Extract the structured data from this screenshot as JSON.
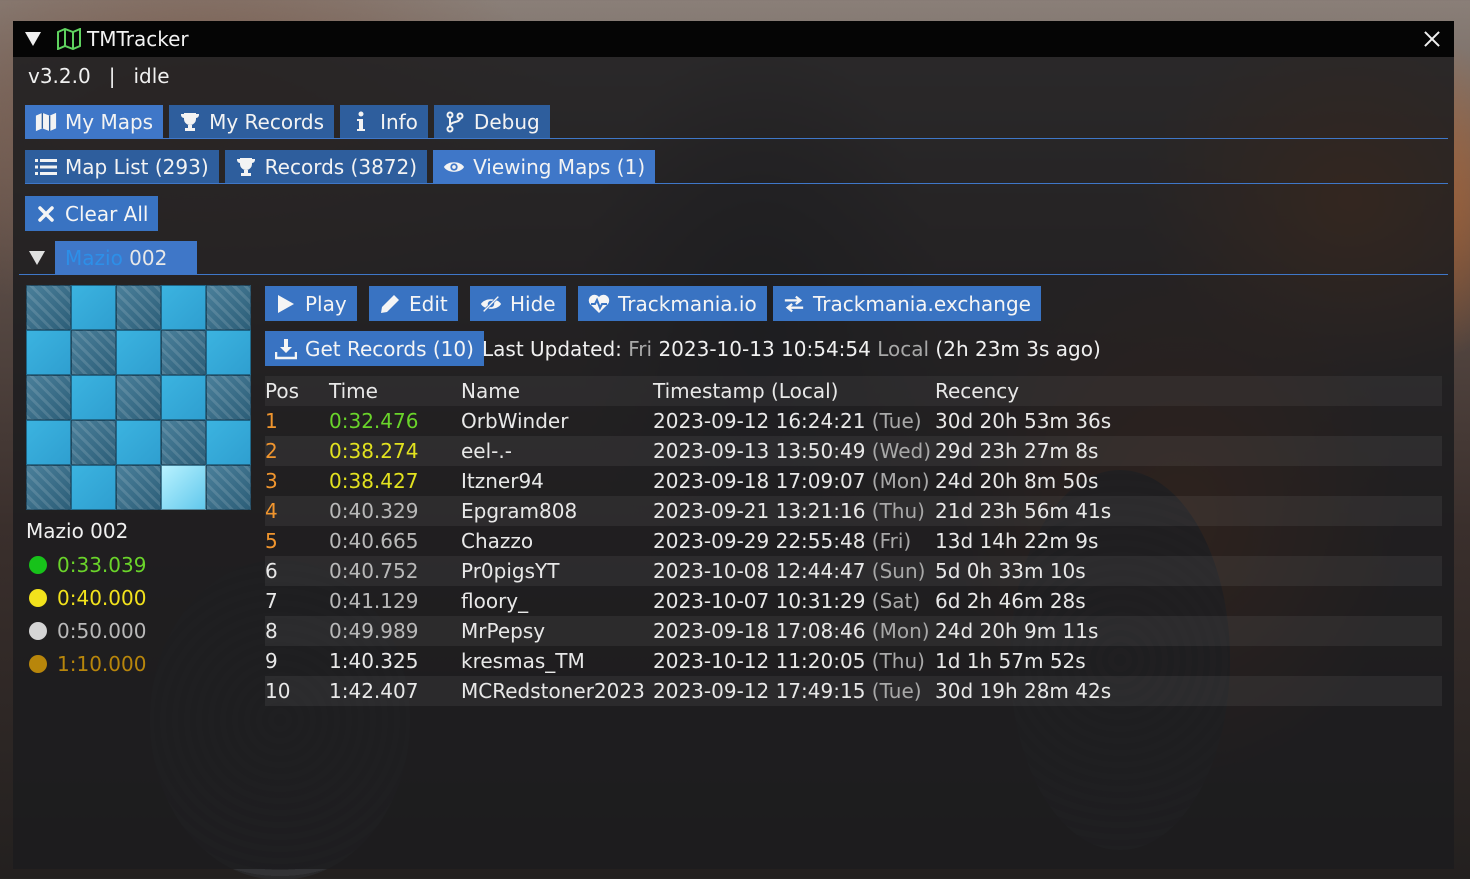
{
  "colors": {
    "accent": "#3f77c8",
    "button": "#3973c2",
    "author_medal": "#17c21a",
    "gold_medal": "#f2e21c",
    "silver_medal": "#d5d5d5",
    "bronze_medal": "#b8860b",
    "rank_top": "#f0952e",
    "time_author": "#6ad42a",
    "time_gold": "#e2e21f"
  },
  "window": {
    "title": "TMTracker",
    "title_icon": "map-icon",
    "version": "v3.2.0",
    "separator": "|",
    "status": "idle"
  },
  "main_tabs": [
    {
      "label": "My Maps",
      "icon": "map-icon"
    },
    {
      "label": "My Records",
      "icon": "trophy-icon"
    },
    {
      "label": "Info",
      "icon": "info-icon"
    },
    {
      "label": "Debug",
      "icon": "code-branch-icon"
    }
  ],
  "sub_tabs": [
    {
      "label": "Map List (293)",
      "icon": "list-icon"
    },
    {
      "label": "Records (3872)",
      "icon": "trophy-icon"
    },
    {
      "label": "Viewing Maps (1)",
      "icon": "eye-icon"
    }
  ],
  "clear_all_label": "Clear All",
  "map_tab": {
    "label_prefix": "Mazio",
    "label_suffix": " 002"
  },
  "map": {
    "name": "Mazio 002",
    "medals": [
      {
        "time": "0:33.039",
        "color": "#17c21a",
        "text_color": "#6ad42a"
      },
      {
        "time": "0:40.000",
        "color": "#f2e21c",
        "text_color": "#f2e21c"
      },
      {
        "time": "0:50.000",
        "color": "#d5d5d5",
        "text_color": "#b9b9b9"
      },
      {
        "time": "1:10.000",
        "color": "#b8860b",
        "text_color": "#b8860b"
      }
    ]
  },
  "actions": {
    "play": "Play",
    "edit": "Edit",
    "hide": "Hide",
    "trackmania_io": "Trackmania.io",
    "trackmania_exchange": "Trackmania.exchange",
    "get_records": "Get Records (10)"
  },
  "last_updated": {
    "label": "Last Updated:",
    "day": "Fri",
    "datetime": "2023-10-13 10:54:54",
    "zone": "Local",
    "ago": "(2h 23m 3s ago)"
  },
  "table": {
    "headers": [
      "Pos",
      "Time",
      "Name",
      "Timestamp (Local)",
      "Recency"
    ],
    "rows": [
      {
        "pos": "1",
        "time": "0:32.476",
        "name": "OrbWinder",
        "ts": "2023-09-12 16:24:21",
        "dow": "(Tue)",
        "recency": "30d 20h 53m 36s",
        "pos_style": "orange",
        "time_style": "green"
      },
      {
        "pos": "2",
        "time": "0:38.274",
        "name": "eel-.-",
        "ts": "2023-09-13 13:50:49",
        "dow": "(Wed)",
        "recency": "29d 23h 27m 8s",
        "pos_style": "orange",
        "time_style": "yellow"
      },
      {
        "pos": "3",
        "time": "0:38.427",
        "name": "Itzner94",
        "ts": "2023-09-18 17:09:07",
        "dow": "(Mon)",
        "recency": "24d 20h 8m 50s",
        "pos_style": "orange",
        "time_style": "yellow"
      },
      {
        "pos": "4",
        "time": "0:40.329",
        "name": "Epgram808",
        "ts": "2023-09-21 13:21:16",
        "dow": "(Thu)",
        "recency": "21d 23h 56m 41s",
        "pos_style": "orange",
        "time_style": "grey"
      },
      {
        "pos": "5",
        "time": "0:40.665",
        "name": "Chazzo",
        "ts": "2023-09-29 22:55:48",
        "dow": "(Fri)",
        "recency": "13d 14h 22m 9s",
        "pos_style": "orange",
        "time_style": "grey"
      },
      {
        "pos": "6",
        "time": "0:40.752",
        "name": "Pr0pigsYT",
        "ts": "2023-10-08 12:44:47",
        "dow": "(Sun)",
        "recency": "5d 0h 33m 10s",
        "pos_style": "white",
        "time_style": "grey"
      },
      {
        "pos": "7",
        "time": "0:41.129",
        "name": "floory_",
        "ts": "2023-10-07 10:31:29",
        "dow": "(Sat)",
        "recency": "6d 2h 46m 28s",
        "pos_style": "white",
        "time_style": "grey"
      },
      {
        "pos": "8",
        "time": "0:49.989",
        "name": "MrPepsy",
        "ts": "2023-09-18 17:08:46",
        "dow": "(Mon)",
        "recency": "24d 20h 9m 11s",
        "pos_style": "white",
        "time_style": "grey"
      },
      {
        "pos": "9",
        "time": "1:40.325",
        "name": "kresmas_TM",
        "ts": "2023-10-12 11:20:05",
        "dow": "(Thu)",
        "recency": "1d 1h 57m 52s",
        "pos_style": "white",
        "time_style": "white"
      },
      {
        "pos": "10",
        "time": "1:42.407",
        "name": "MCRedstoner2023",
        "ts": "2023-09-12 17:49:15",
        "dow": "(Tue)",
        "recency": "30d 19h 28m 42s",
        "pos_style": "white",
        "time_style": "white"
      }
    ]
  }
}
